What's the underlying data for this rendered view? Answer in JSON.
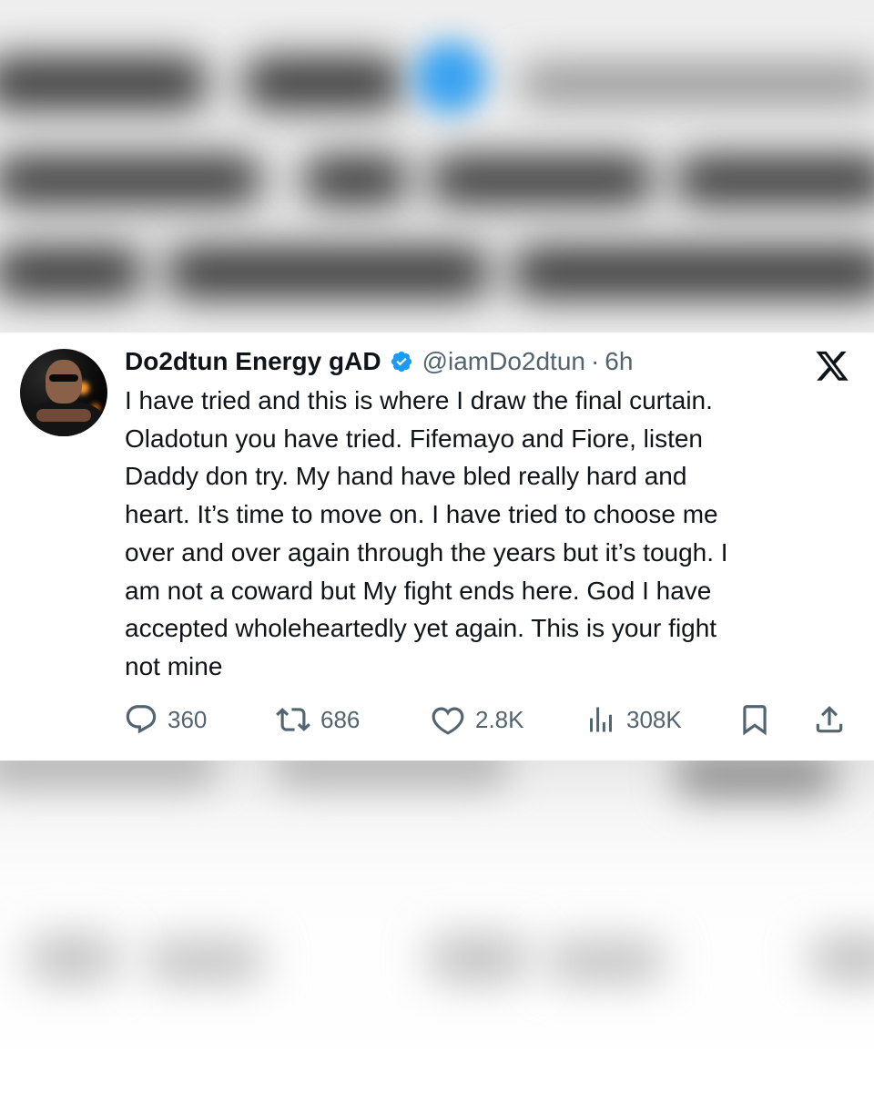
{
  "tweet": {
    "display_name": "Do2dtun Energy gAD",
    "handle": "@iamDo2dtun",
    "separator": "·",
    "time": "6h",
    "text_lines": [
      "I have tried and this is where I draw the final curtain.",
      "Oladotun you have tried. Fifemayo and Fiore, listen",
      "Daddy don try. My hand have bled really hard and",
      "heart. It’s time to move on. I have tried to choose me",
      "over and over again through the years but it’s tough. I",
      "am not a coward but My fight ends here. God I have",
      "accepted wholeheartedly yet again. This is your fight",
      "not mine"
    ],
    "stats": {
      "replies": "360",
      "reposts": "686",
      "likes": "2.8K",
      "views": "308K"
    }
  },
  "icons": {
    "verified": "verified-badge-icon",
    "platform": "x-logo-icon",
    "reply": "reply-icon",
    "repost": "repost-icon",
    "like": "heart-icon",
    "views": "views-chart-icon",
    "bookmark": "bookmark-icon",
    "share": "share-icon"
  },
  "colors": {
    "text_primary": "#0f1419",
    "text_secondary": "#536471",
    "verified_blue": "#1d9bf0",
    "card_background": "#ffffff"
  }
}
